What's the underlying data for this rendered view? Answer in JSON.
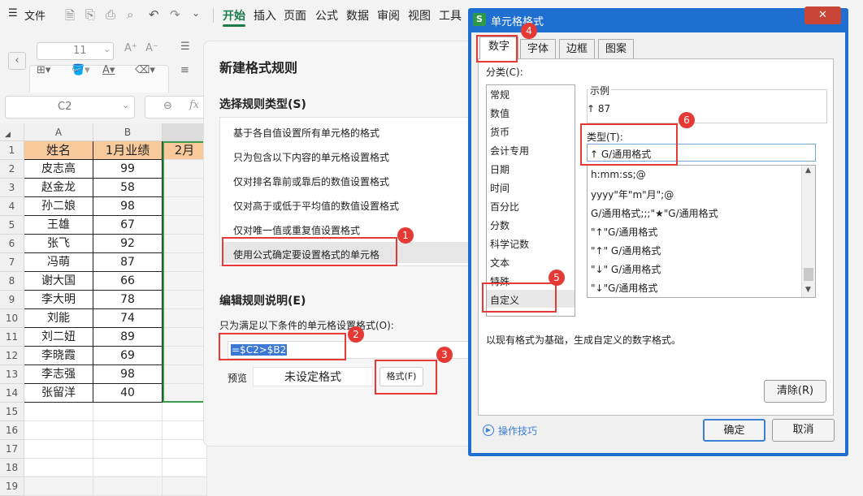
{
  "menubar": {
    "file": "文件",
    "items": [
      "开始",
      "插入",
      "页面",
      "公式",
      "数据",
      "审阅",
      "视图",
      "工具"
    ]
  },
  "ribbon": {
    "font_size": "11"
  },
  "namebox": {
    "value": "C2"
  },
  "fx_label": "fx",
  "sheet": {
    "columns": [
      "A",
      "B",
      "2月"
    ],
    "col_letters": [
      "A",
      "B"
    ],
    "header": [
      "姓名",
      "1月业绩",
      "2月"
    ],
    "rows": [
      {
        "n": "1"
      },
      {
        "n": "2",
        "name": "皮志高",
        "v": "99"
      },
      {
        "n": "3",
        "name": "赵金龙",
        "v": "58"
      },
      {
        "n": "4",
        "name": "孙二娘",
        "v": "98"
      },
      {
        "n": "5",
        "name": "王雄",
        "v": "67"
      },
      {
        "n": "6",
        "name": "张飞",
        "v": "92"
      },
      {
        "n": "7",
        "name": "冯萌",
        "v": "87"
      },
      {
        "n": "8",
        "name": "谢大国",
        "v": "66"
      },
      {
        "n": "9",
        "name": "李大明",
        "v": "78"
      },
      {
        "n": "10",
        "name": "刘能",
        "v": "74"
      },
      {
        "n": "11",
        "name": "刘二妞",
        "v": "89"
      },
      {
        "n": "12",
        "name": "李晓霞",
        "v": "69"
      },
      {
        "n": "13",
        "name": "李志强",
        "v": "98"
      },
      {
        "n": "14",
        "name": "张留洋",
        "v": "40"
      },
      {
        "n": "15"
      },
      {
        "n": "16"
      },
      {
        "n": "17"
      },
      {
        "n": "18"
      },
      {
        "n": "19"
      }
    ]
  },
  "rule_dialog": {
    "title": "新建格式规则",
    "select_type": "选择规则类型(S)",
    "types": [
      "基于各自值设置所有单元格的格式",
      "只为包含以下内容的单元格设置格式",
      "仅对排名靠前或靠后的数值设置格式",
      "仅对高于或低于平均值的数值设置格式",
      "仅对唯一值或重复值设置格式",
      "使用公式确定要设置格式的单元格"
    ],
    "edit_desc": "编辑规则说明(E)",
    "formula_label": "只为满足以下条件的单元格设置格式(O):",
    "formula": "=$C2>$B2",
    "preview_label": "预览",
    "preview_text": "未设定格式",
    "format_button": "格式(F)"
  },
  "format_dialog": {
    "title": "单元格格式",
    "tabs": [
      "数字",
      "字体",
      "边框",
      "图案"
    ],
    "category_label": "分类(C):",
    "categories": [
      "常规",
      "数值",
      "货币",
      "会计专用",
      "日期",
      "时间",
      "百分比",
      "分数",
      "科学记数",
      "文本",
      "特殊",
      "自定义"
    ],
    "sample_label": "示例",
    "sample_value": "↑ 87",
    "type_label": "类型(T):",
    "type_value": "↑ G/通用格式",
    "type_list": [
      "h:mm:ss;@",
      "yyyy\"年\"m\"月\";@",
      "G/通用格式;;;\"★\"G/通用格式",
      "\"↑\"G/通用格式",
      "\"↑\" G/通用格式",
      "\"↓\" G/通用格式",
      "\"↓\"G/通用格式"
    ],
    "description": "以现有格式为基础，生成自定义的数字格式。",
    "clear_button": "清除(R)",
    "tips_link": "操作技巧",
    "ok_button": "确定",
    "cancel_button": "取消",
    "close_icon": "✕"
  },
  "badges": [
    "1",
    "2",
    "3",
    "4",
    "5",
    "6"
  ],
  "colors": {
    "accent": "#1a7b49",
    "header_fill": "#f8c99b",
    "annotation": "#e53935",
    "title_bar": "#1f6fd0"
  }
}
